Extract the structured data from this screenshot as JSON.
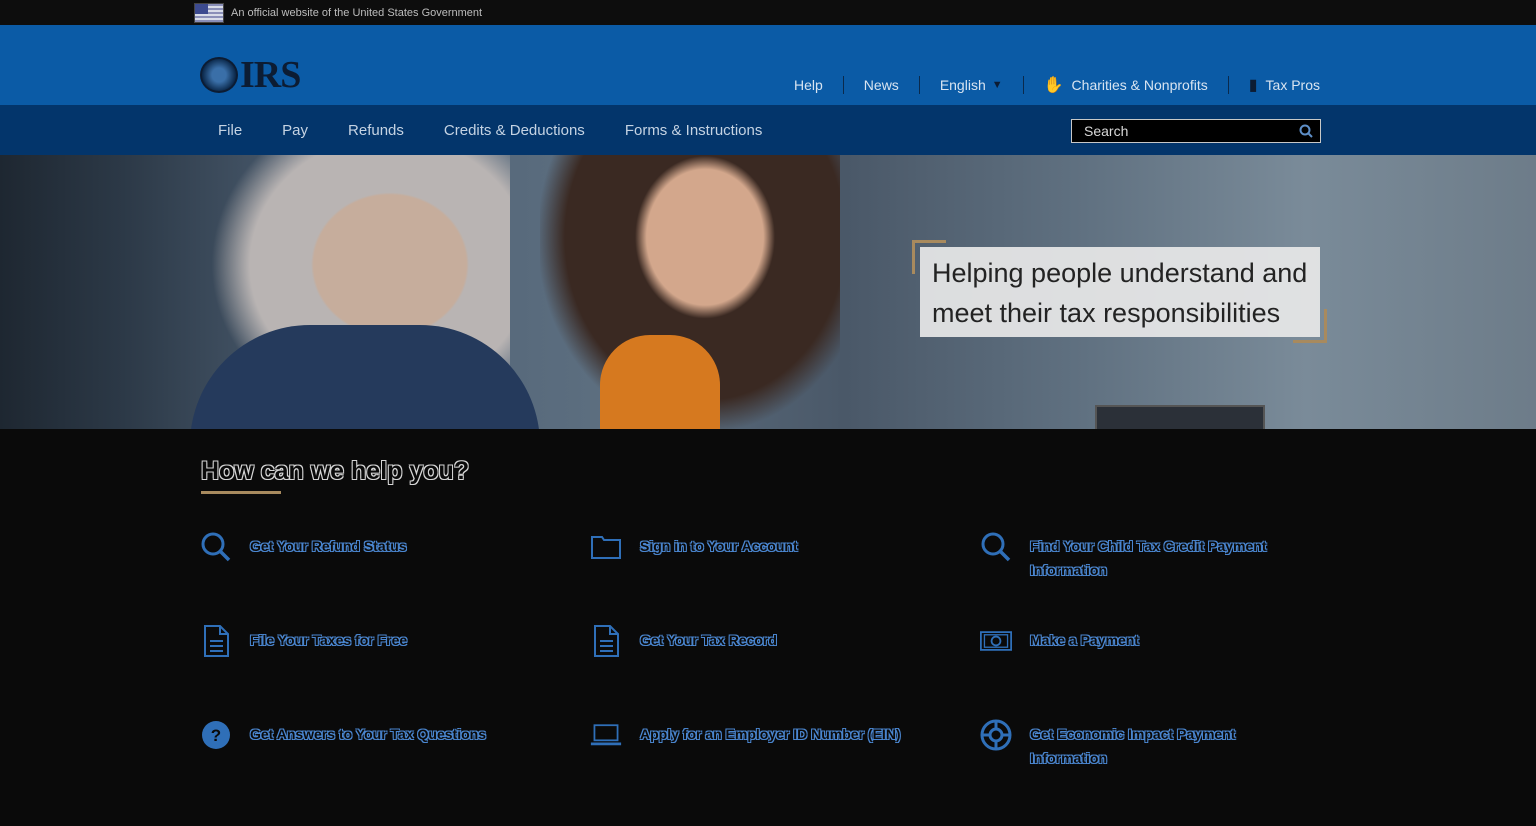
{
  "banner": {
    "text": "An official website of the United States Government"
  },
  "header": {
    "logo_text": "IRS",
    "util_nav": [
      {
        "label": "Help"
      },
      {
        "label": "News"
      },
      {
        "label": "English"
      },
      {
        "label": "Charities & Nonprofits"
      },
      {
        "label": "Tax Pros"
      }
    ]
  },
  "main_nav": {
    "items": [
      {
        "label": "File"
      },
      {
        "label": "Pay"
      },
      {
        "label": "Refunds"
      },
      {
        "label": "Credits & Deductions"
      },
      {
        "label": "Forms & Instructions"
      }
    ],
    "search_placeholder": "Search"
  },
  "hero": {
    "tagline": "Helping people understand and meet their tax responsibilities"
  },
  "help": {
    "heading": "How can we help you?",
    "tasks": [
      {
        "label": "Get Your Refund Status",
        "icon": "search-icon"
      },
      {
        "label": "Sign in to Your Account",
        "icon": "folder-icon"
      },
      {
        "label": "Find Your Child Tax Credit Payment Information",
        "icon": "search-icon"
      },
      {
        "label": "File Your Taxes for Free",
        "icon": "document-icon"
      },
      {
        "label": "Get Your Tax Record",
        "icon": "document-icon"
      },
      {
        "label": "Make a Payment",
        "icon": "cash-icon"
      },
      {
        "label": "Get Answers to Your Tax Questions",
        "icon": "question-icon"
      },
      {
        "label": "Apply for an Employer ID Number (EIN)",
        "icon": "laptop-icon"
      },
      {
        "label": "Get Economic Impact Payment Information",
        "icon": "life-ring-icon"
      }
    ]
  },
  "colors": {
    "header_blue": "#0b5ba6",
    "nav_blue": "#03356b",
    "accent_gold": "#a88a5e",
    "link_blue": "#4b87d1"
  }
}
